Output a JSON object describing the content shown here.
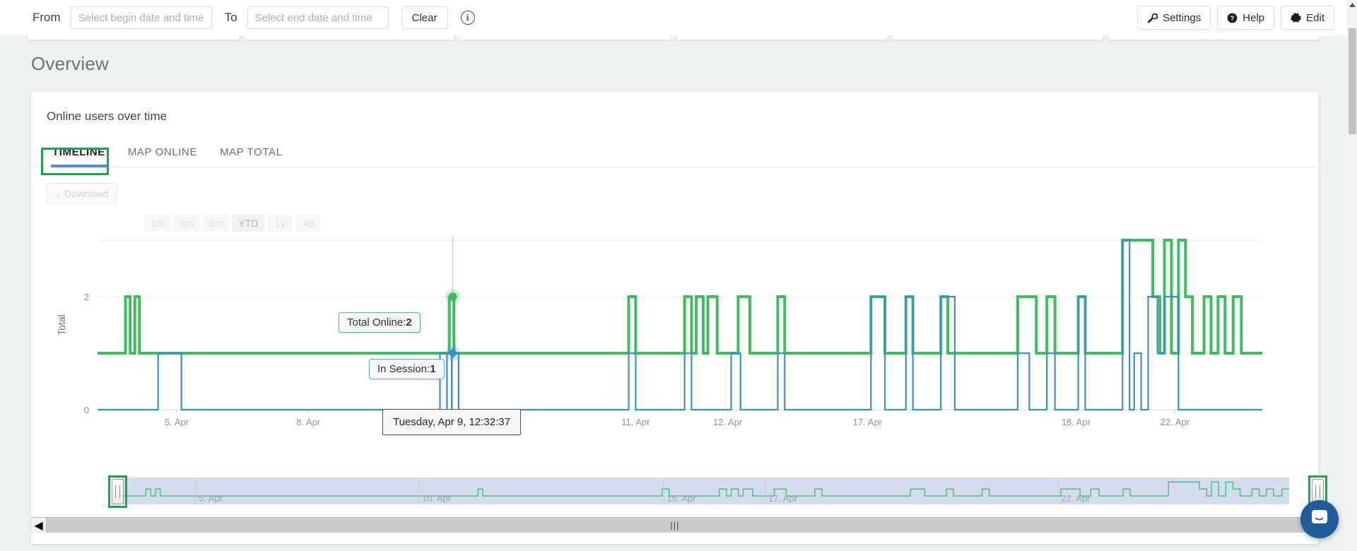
{
  "topbar": {
    "from_label": "From",
    "begin_placeholder": "Select begin date and time",
    "begin_value": "",
    "to_label": "To",
    "end_placeholder": "Select end date and time",
    "end_value": "",
    "clear_label": "Clear",
    "info_glyph": "i",
    "settings_label": "Settings",
    "help_label": "Help",
    "edit_label": "Edit"
  },
  "page": {
    "title": "Overview"
  },
  "panel": {
    "title": "Online users over time",
    "tabs": [
      {
        "label": "TIMELINE",
        "active": true,
        "highlighted": true
      },
      {
        "label": "MAP ONLINE",
        "active": false,
        "highlighted": false
      },
      {
        "label": "MAP TOTAL",
        "active": false,
        "highlighted": false
      }
    ],
    "download_label": "Download",
    "download_icon": "download-arrow-icon",
    "range_buttons": [
      {
        "label": "1m",
        "selected": false
      },
      {
        "label": "3m",
        "selected": false
      },
      {
        "label": "6m",
        "selected": false
      },
      {
        "label": "YTD",
        "selected": true
      },
      {
        "label": "1y",
        "selected": false
      },
      {
        "label": "All",
        "selected": false
      }
    ]
  },
  "tooltips": {
    "total_online": {
      "label": "Total Online:",
      "value": "2",
      "color": "#3fbd5e"
    },
    "in_session": {
      "label": "In Session:",
      "value": "1",
      "color": "#3a8ed0"
    },
    "date": "Tuesday, Apr 9, 12:32:37"
  },
  "colors": {
    "total_online": "#3fbd5e",
    "in_session": "#3a8ed0",
    "tab_underline": "#4a90d9",
    "highlight": "#18a84b",
    "navigator_fill": "#ccd6ea"
  },
  "chart_data": {
    "type": "line",
    "title": "Online users over time",
    "xlabel": "",
    "ylabel": "Total",
    "ylim": [
      0,
      3
    ],
    "yticks": [
      0,
      2
    ],
    "ytick_labels": [
      "0",
      "2"
    ],
    "grid": true,
    "legend_position": "none",
    "xtick_labels": [
      "5. Apr",
      "8. Apr",
      "11. Apr",
      "12. Apr",
      "17. Apr",
      "18. Apr",
      "22. Apr"
    ],
    "xtick_positions": [
      0.068,
      0.181,
      0.462,
      0.541,
      0.661,
      0.84,
      0.925
    ],
    "crosshair_x": 0.305,
    "step": "stepped-square-wave",
    "series": [
      {
        "name": "Total Online",
        "color": "#3fbd5e",
        "baseline": 1,
        "points": [
          [
            0.0,
            1
          ],
          [
            0.02,
            1
          ],
          [
            0.024,
            2
          ],
          [
            0.028,
            1
          ],
          [
            0.032,
            2
          ],
          [
            0.036,
            1
          ],
          [
            0.04,
            1
          ],
          [
            0.3,
            1
          ],
          [
            0.302,
            2
          ],
          [
            0.306,
            1
          ],
          [
            0.31,
            1
          ],
          [
            0.452,
            1
          ],
          [
            0.456,
            2
          ],
          [
            0.462,
            1
          ],
          [
            0.47,
            1
          ],
          [
            0.5,
            1
          ],
          [
            0.504,
            2
          ],
          [
            0.51,
            1
          ],
          [
            0.514,
            2
          ],
          [
            0.52,
            1
          ],
          [
            0.524,
            2
          ],
          [
            0.532,
            1
          ],
          [
            0.546,
            1
          ],
          [
            0.55,
            2
          ],
          [
            0.56,
            1
          ],
          [
            0.58,
            1
          ],
          [
            0.584,
            2
          ],
          [
            0.59,
            1
          ],
          [
            0.66,
            1
          ],
          [
            0.664,
            2
          ],
          [
            0.676,
            1
          ],
          [
            0.69,
            1
          ],
          [
            0.694,
            2
          ],
          [
            0.7,
            1
          ],
          [
            0.72,
            1
          ],
          [
            0.724,
            2
          ],
          [
            0.73,
            1
          ],
          [
            0.79,
            2
          ],
          [
            0.806,
            1
          ],
          [
            0.815,
            2
          ],
          [
            0.822,
            1
          ],
          [
            0.838,
            1
          ],
          [
            0.842,
            2
          ],
          [
            0.848,
            1
          ],
          [
            0.88,
            3
          ],
          [
            0.9,
            3
          ],
          [
            0.906,
            2
          ],
          [
            0.912,
            1
          ],
          [
            0.916,
            3
          ],
          [
            0.922,
            1
          ],
          [
            0.928,
            3
          ],
          [
            0.934,
            2
          ],
          [
            0.94,
            1
          ],
          [
            0.95,
            2
          ],
          [
            0.956,
            1
          ],
          [
            0.962,
            2
          ],
          [
            0.968,
            1
          ],
          [
            0.975,
            2
          ],
          [
            0.982,
            1
          ],
          [
            1.0,
            1
          ]
        ]
      },
      {
        "name": "In Session",
        "color": "#3a8ed0",
        "baseline": 0,
        "points": [
          [
            0.0,
            0
          ],
          [
            0.048,
            0
          ],
          [
            0.052,
            1
          ],
          [
            0.068,
            1
          ],
          [
            0.072,
            0
          ],
          [
            0.29,
            0
          ],
          [
            0.294,
            1
          ],
          [
            0.3,
            0
          ],
          [
            0.304,
            1
          ],
          [
            0.31,
            0
          ],
          [
            0.452,
            0
          ],
          [
            0.456,
            1
          ],
          [
            0.462,
            0
          ],
          [
            0.5,
            0
          ],
          [
            0.504,
            1
          ],
          [
            0.51,
            0
          ],
          [
            0.54,
            0
          ],
          [
            0.544,
            1
          ],
          [
            0.552,
            0
          ],
          [
            0.58,
            0
          ],
          [
            0.584,
            1
          ],
          [
            0.59,
            0
          ],
          [
            0.66,
            0
          ],
          [
            0.664,
            2
          ],
          [
            0.676,
            0
          ],
          [
            0.69,
            0
          ],
          [
            0.694,
            2
          ],
          [
            0.7,
            0
          ],
          [
            0.72,
            0
          ],
          [
            0.724,
            2
          ],
          [
            0.736,
            0
          ],
          [
            0.79,
            1
          ],
          [
            0.8,
            0
          ],
          [
            0.815,
            1
          ],
          [
            0.822,
            0
          ],
          [
            0.838,
            0
          ],
          [
            0.842,
            2
          ],
          [
            0.848,
            0
          ],
          [
            0.88,
            3
          ],
          [
            0.886,
            0
          ],
          [
            0.89,
            1
          ],
          [
            0.896,
            0
          ],
          [
            0.902,
            2
          ],
          [
            0.91,
            1
          ],
          [
            0.916,
            2
          ],
          [
            0.928,
            0
          ],
          [
            1.0,
            0
          ]
        ]
      }
    ],
    "navigator": {
      "xtick_labels": [
        "5. Apr",
        "10. Apr",
        "15. Apr",
        "17. Apr",
        "22. Apr"
      ],
      "series_color": "#44c07e",
      "selection_start": 0.0,
      "selection_end": 1.0
    }
  },
  "scrollbar": {
    "left_arrow": "◀",
    "grip": "|||"
  },
  "chat": {
    "icon": "chat-bubble-icon"
  }
}
